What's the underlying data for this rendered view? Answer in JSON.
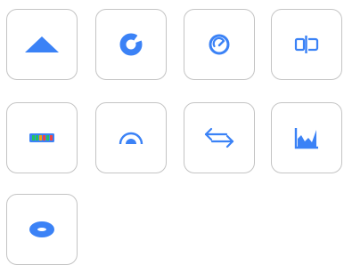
{
  "accent_color": "#3b82f6",
  "tiles": [
    {
      "icon": "triangle-up-icon"
    },
    {
      "icon": "donut-chart-icon"
    },
    {
      "icon": "gauge-icon"
    },
    {
      "icon": "compare-bars-icon"
    },
    {
      "icon": "battery-bar-icon"
    },
    {
      "icon": "half-donut-icon"
    },
    {
      "icon": "bidirectional-arrows-icon"
    },
    {
      "icon": "area-chart-icon"
    },
    {
      "icon": "ellipse-ring-icon"
    }
  ]
}
